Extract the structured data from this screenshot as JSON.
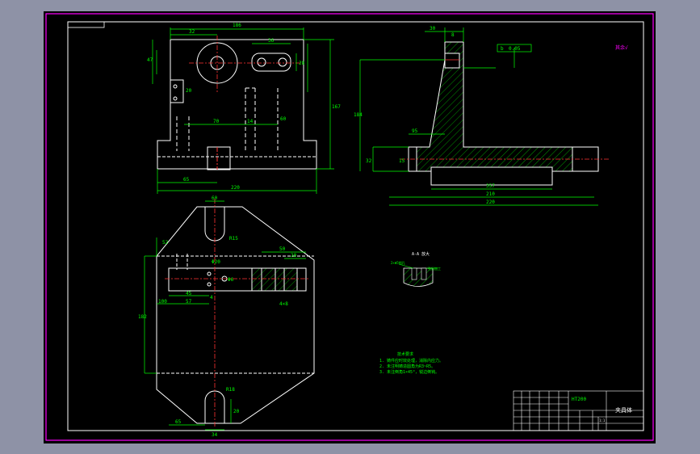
{
  "colors": {
    "background": "#8e92a6",
    "sheet": "#000000",
    "frame": "#ff00ff",
    "outline": "#ffffff",
    "dimension": "#00ff00",
    "centerline": "#ff3333",
    "hatch": "#00ff00",
    "titleblock": "#ffffff"
  },
  "front_view": {
    "dims": {
      "top_width": "186",
      "hole_offset": "32",
      "height_left": "47",
      "slot_width": "36",
      "slot_len": "28",
      "left_h": "20",
      "depth_small": "14",
      "mid_width": "70",
      "right_h": "60",
      "total_height": "167",
      "bottom_left": "65",
      "base_width": "220"
    }
  },
  "side_view": {
    "dims": {
      "top_a": "30",
      "top_b": "8",
      "gd_t": "0.05",
      "datum": "b",
      "height": "184",
      "left_step": "95",
      "base_h": "32",
      "thick": "15",
      "inner": "357",
      "mid": "210",
      "total": "220"
    }
  },
  "top_view": {
    "dims": {
      "top": "60",
      "r_slot": "R15",
      "left_w": "52",
      "right_a": "50",
      "right_b": "20",
      "dia": "Φ20",
      "hole": "Φ6",
      "left_h": "182",
      "b1": "45",
      "b2": "100",
      "b3": "57",
      "k": "4",
      "m": "4×8",
      "r_bottom": "R18",
      "bottom_l": "65",
      "bottom_r": "34",
      "side_r": "20"
    }
  },
  "detail": {
    "title": "A-A 放大",
    "label_left": "2×Φ5销孔",
    "label_right": "孔后加工"
  },
  "notes": {
    "title": "技术要求",
    "items": [
      "1. 铸件应时效处理，消除内应力。",
      "2. 未注明铸造圆角为R3~R5。",
      "3. 未注倒角1×45°，锐边倒钝。"
    ]
  },
  "roughness": "其余√",
  "title_block": {
    "material": "HT200",
    "part_name": "夹具体",
    "scale": "1:1"
  }
}
